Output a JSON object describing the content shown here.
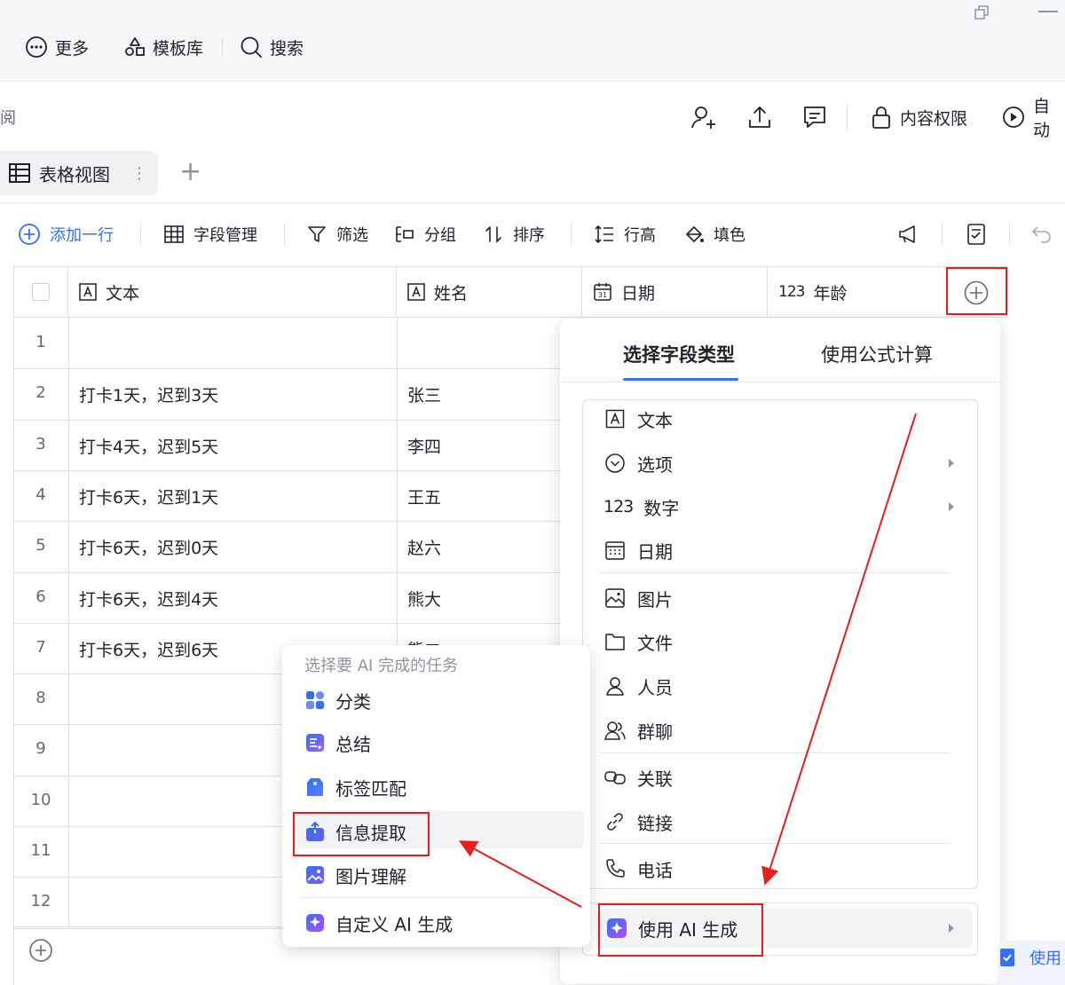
{
  "topbar": {
    "more": "更多",
    "templates": "模板库",
    "search": "搜索"
  },
  "second_toolbar": {
    "left_cut_text": "阅",
    "permissions": "内容权限",
    "auto_cut": "自动"
  },
  "view": {
    "tab_label": "表格视图",
    "more_dots": "⋮",
    "add_view": "+"
  },
  "toolbar": {
    "add_row": "添加一行",
    "field_manage": "字段管理",
    "filter": "筛选",
    "group": "分组",
    "sort": "排序",
    "row_height": "行高",
    "fill_color": "填色"
  },
  "table": {
    "headers": [
      {
        "label": "文本",
        "icon": "text-field-icon"
      },
      {
        "label": "姓名",
        "icon": "text-field-icon"
      },
      {
        "label": "日期",
        "icon": "calendar-icon"
      },
      {
        "label": "年龄",
        "prefix": "123",
        "icon": "number-icon"
      }
    ],
    "rows": [
      {
        "num": "1",
        "text": "",
        "name": ""
      },
      {
        "num": "2",
        "text": "打卡1天，迟到3天",
        "name": "张三"
      },
      {
        "num": "3",
        "text": "打卡4天，迟到5天",
        "name": "李四"
      },
      {
        "num": "4",
        "text": "打卡6天，迟到1天",
        "name": "王五"
      },
      {
        "num": "5",
        "text": "打卡6天，迟到0天",
        "name": "赵六"
      },
      {
        "num": "6",
        "text": "打卡6天，迟到4天",
        "name": "熊大"
      },
      {
        "num": "7",
        "text": "打卡6天，迟到6天",
        "name": "熊二"
      },
      {
        "num": "8",
        "text": "",
        "name": ""
      },
      {
        "num": "9",
        "text": "",
        "name": ""
      },
      {
        "num": "10",
        "text": "",
        "name": ""
      },
      {
        "num": "11",
        "text": "",
        "name": ""
      },
      {
        "num": "12",
        "text": "",
        "name": ""
      }
    ]
  },
  "field_panel": {
    "tab_types": "选择字段类型",
    "tab_formula": "使用公式计算",
    "items": [
      {
        "label": "文本",
        "icon": "text-field-icon"
      },
      {
        "label": "选项",
        "icon": "dropdown-icon",
        "submenu": true
      },
      {
        "label": "数字",
        "prefix": "123",
        "icon": "number-icon",
        "submenu": true
      },
      {
        "label": "日期",
        "icon": "calendar-icon"
      },
      {
        "label": "图片",
        "icon": "image-icon"
      },
      {
        "label": "文件",
        "icon": "folder-icon"
      },
      {
        "label": "人员",
        "icon": "person-icon"
      },
      {
        "label": "群聊",
        "icon": "group-icon"
      },
      {
        "label": "关联",
        "icon": "link-chain-icon"
      },
      {
        "label": "链接",
        "icon": "url-link-icon"
      },
      {
        "label": "电话",
        "icon": "phone-icon"
      }
    ],
    "ai_item": "使用 AI 生成"
  },
  "ai_popup": {
    "heading": "选择要 AI 完成的任务",
    "items": [
      {
        "label": "分类",
        "icon": "classify-icon"
      },
      {
        "label": "总结",
        "icon": "summary-icon"
      },
      {
        "label": "标签匹配",
        "icon": "tag-icon"
      },
      {
        "label": "信息提取",
        "icon": "extract-icon"
      },
      {
        "label": "图片理解",
        "icon": "image-understand-icon"
      },
      {
        "label": "自定义 AI 生成",
        "icon": "ai-sparkle-icon"
      }
    ]
  },
  "bottom_right_cut": "使用",
  "colors": {
    "accent": "#3370ff",
    "annotation": "#ea1c1c",
    "border": "#dee0e3"
  }
}
